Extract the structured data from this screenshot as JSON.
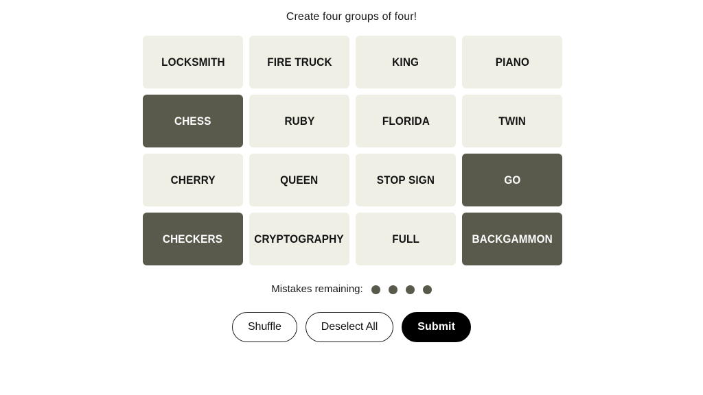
{
  "game": {
    "title": "Create four groups of four!",
    "colors": {
      "page_background": "#ffffff",
      "tile_unselected": "#efefe6",
      "tile_selected": "#5a5a4c",
      "tile_unselected_text": "#121212",
      "tile_selected_text": "#ffffff",
      "mistake_dot": "#5a5a4c",
      "submit_background": "#000000"
    }
  },
  "grid": {
    "rows": 4,
    "columns": 4,
    "tiles": [
      {
        "label": "LOCKSMITH",
        "selected": false
      },
      {
        "label": "FIRE TRUCK",
        "selected": false
      },
      {
        "label": "KING",
        "selected": false
      },
      {
        "label": "PIANO",
        "selected": false
      },
      {
        "label": "CHESS",
        "selected": true
      },
      {
        "label": "RUBY",
        "selected": false
      },
      {
        "label": "FLORIDA",
        "selected": false
      },
      {
        "label": "TWIN",
        "selected": false
      },
      {
        "label": "CHERRY",
        "selected": false
      },
      {
        "label": "QUEEN",
        "selected": false
      },
      {
        "label": "STOP SIGN",
        "selected": false
      },
      {
        "label": "GO",
        "selected": true
      },
      {
        "label": "CHECKERS",
        "selected": true
      },
      {
        "label": "CRYPTOGRAPHY",
        "selected": false
      },
      {
        "label": "FULL",
        "selected": false
      },
      {
        "label": "BACKGAMMON",
        "selected": true
      }
    ],
    "selected_count": 4
  },
  "mistakes": {
    "label": "Mistakes remaining:",
    "remaining": 4
  },
  "buttons": [
    {
      "label": "Shuffle",
      "name": "shuffle-button",
      "style": "outline"
    },
    {
      "label": "Deselect All",
      "name": "deselect-all-button",
      "style": "outline"
    },
    {
      "label": "Submit",
      "name": "submit-button",
      "style": "filled"
    }
  ]
}
